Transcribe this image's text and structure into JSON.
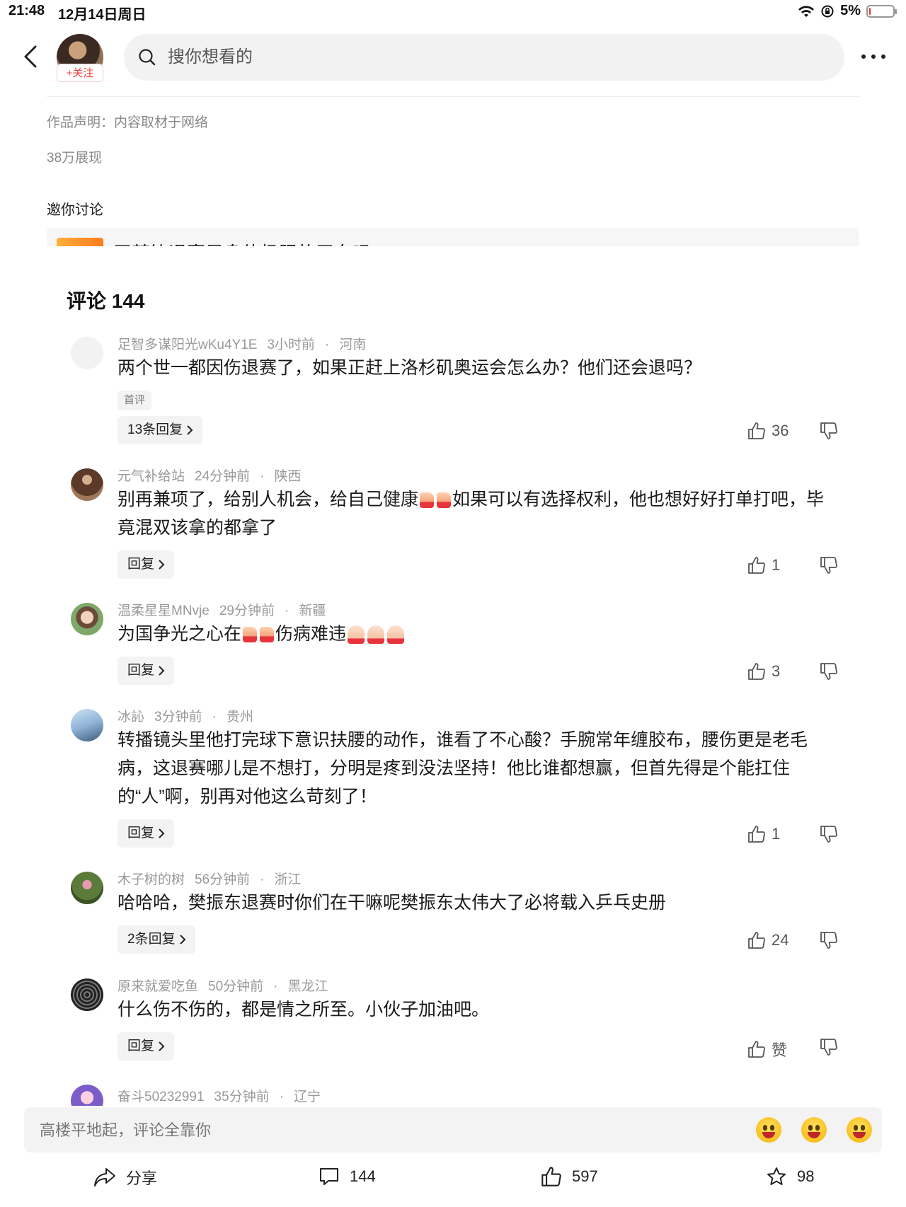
{
  "status_bar": {
    "time": "21:48",
    "date": "12月14日周日",
    "battery": "5%",
    "battery_level": 0.05
  },
  "header": {
    "follow_label": "+关注",
    "search_placeholder": "搜你想看的"
  },
  "article": {
    "statement": "作品声明：内容取材于网络",
    "views": "38万展现",
    "discuss_title": "邀你讨论",
    "topic_text": "王楚钦退赛是身体极限的无奈吗"
  },
  "comments_section": {
    "title": "评论 144"
  },
  "comments": [
    {
      "user": "足智多谋阳光wKu4Y1E",
      "time": "3小时前",
      "region": "河南",
      "text": "两个世一都因伤退赛了，如果正赶上洛杉矶奥运会怎么办？他们还会退吗？",
      "tag": "首评",
      "reply_label": "13条回复",
      "likes": "36"
    },
    {
      "user": "元气补给站",
      "time": "24分钟前",
      "region": "陕西",
      "text_a": "别再兼项了，给别人机会，给自己健康",
      "text_b": "如果可以有选择权利，他也想好好打单打吧，毕竟混双该拿的都拿了",
      "reply_label": "回复",
      "likes": "1"
    },
    {
      "user": "温柔星星MNvje",
      "time": "29分钟前",
      "region": "新疆",
      "text_a": "为国争光之心在",
      "text_b": "伤病难违",
      "reply_label": "回复",
      "likes": "3"
    },
    {
      "user": "冰訫",
      "time": "3分钟前",
      "region": "贵州",
      "text": "转播镜头里他打完球下意识扶腰的动作，谁看了不心酸？手腕常年缠胶布，腰伤更是老毛病，这退赛哪儿是不想打，分明是疼到没法坚持！他比谁都想赢，但首先得是个能扛住的“人”啊，别再对他这么苛刻了！",
      "reply_label": "回复",
      "likes": "1"
    },
    {
      "user": "木子树的树",
      "time": "56分钟前",
      "region": "浙江",
      "text": "哈哈哈，樊振东退赛时你们在干嘛呢樊振东太伟大了必将载入乒乓史册",
      "reply_label": "2条回复",
      "likes": "24"
    },
    {
      "user": "原来就爱吃鱼",
      "time": "50分钟前",
      "region": "黑龙江",
      "text": "什么伤不伤的，都是情之所至。小伙子加油吧。",
      "reply_label": "回复",
      "likes": "赞"
    },
    {
      "user": "奋斗50232991",
      "time": "35分钟前",
      "region": "辽宁"
    }
  ],
  "input_bar": {
    "placeholder": "高楼平地起，评论全靠你"
  },
  "bottom_bar": {
    "share_label": "分享",
    "comment_count": "144",
    "like_count": "597",
    "favorite_count": "98"
  },
  "colors": {
    "accent_red": "#f0413a",
    "background": "#ffffff",
    "muted_text": "#999999"
  }
}
